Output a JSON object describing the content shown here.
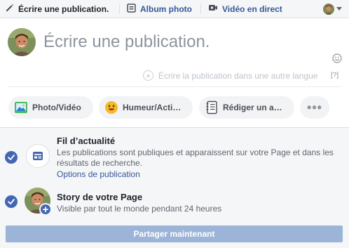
{
  "tabs": {
    "write": "Écrire une publication.",
    "album": "Album photo",
    "live": "Vidéo en direct"
  },
  "composer": {
    "placeholder": "Écrire une publication.",
    "translate": "Écrire la publication dans une autre langue",
    "help": "[?]"
  },
  "actions": {
    "photo": "Photo/Vidéo",
    "mood": "Humeur/Acti…",
    "note": "Rédiger un a…",
    "more": "•••"
  },
  "audience": {
    "feed_title": "Fil d’actualité",
    "feed_desc": "Les publications sont publiques et apparaissent sur votre Page et dans les résultats de recherche.",
    "feed_link": "Options de publication",
    "story_title": "Story de votre Page",
    "story_desc": "Visible par tout le monde pendant 24 heures",
    "story_plus": "+"
  },
  "share_button": "Partager maintenant",
  "colors": {
    "accent": "#4267b2",
    "link": "#365899",
    "share_disabled": "#9cb4d8"
  }
}
